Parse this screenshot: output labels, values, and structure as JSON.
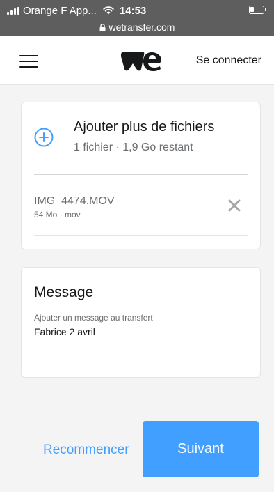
{
  "status_bar": {
    "carrier": "Orange F App...",
    "time": "14:53",
    "url": "wetransfer.com",
    "icons": [
      "signal-icon",
      "wifi-icon",
      "lock-icon",
      "battery-icon"
    ]
  },
  "header": {
    "logo_icon": "wetransfer-logo",
    "menu_icon": "hamburger-icon",
    "login_label": "Se connecter"
  },
  "files_card": {
    "add_icon": "plus-circle-icon",
    "add_title": "Ajouter plus de fichiers",
    "add_subtitle": "1 fichier · 1,9 Go restant",
    "files": [
      {
        "name": "IMG_4474.MOV",
        "meta": "54 Mo · mov",
        "remove_icon": "close-icon"
      }
    ]
  },
  "message_card": {
    "title": "Message",
    "label": "Ajouter un message au transfert",
    "value": "Fabrice 2 avril"
  },
  "actions": {
    "restart_label": "Recommencer",
    "next_label": "Suivant"
  },
  "colors": {
    "accent": "#409fff",
    "status_bar": "#5e5e5e",
    "background": "#f4f4f5",
    "text": "#17181a",
    "muted_text": "#6a6d70"
  }
}
